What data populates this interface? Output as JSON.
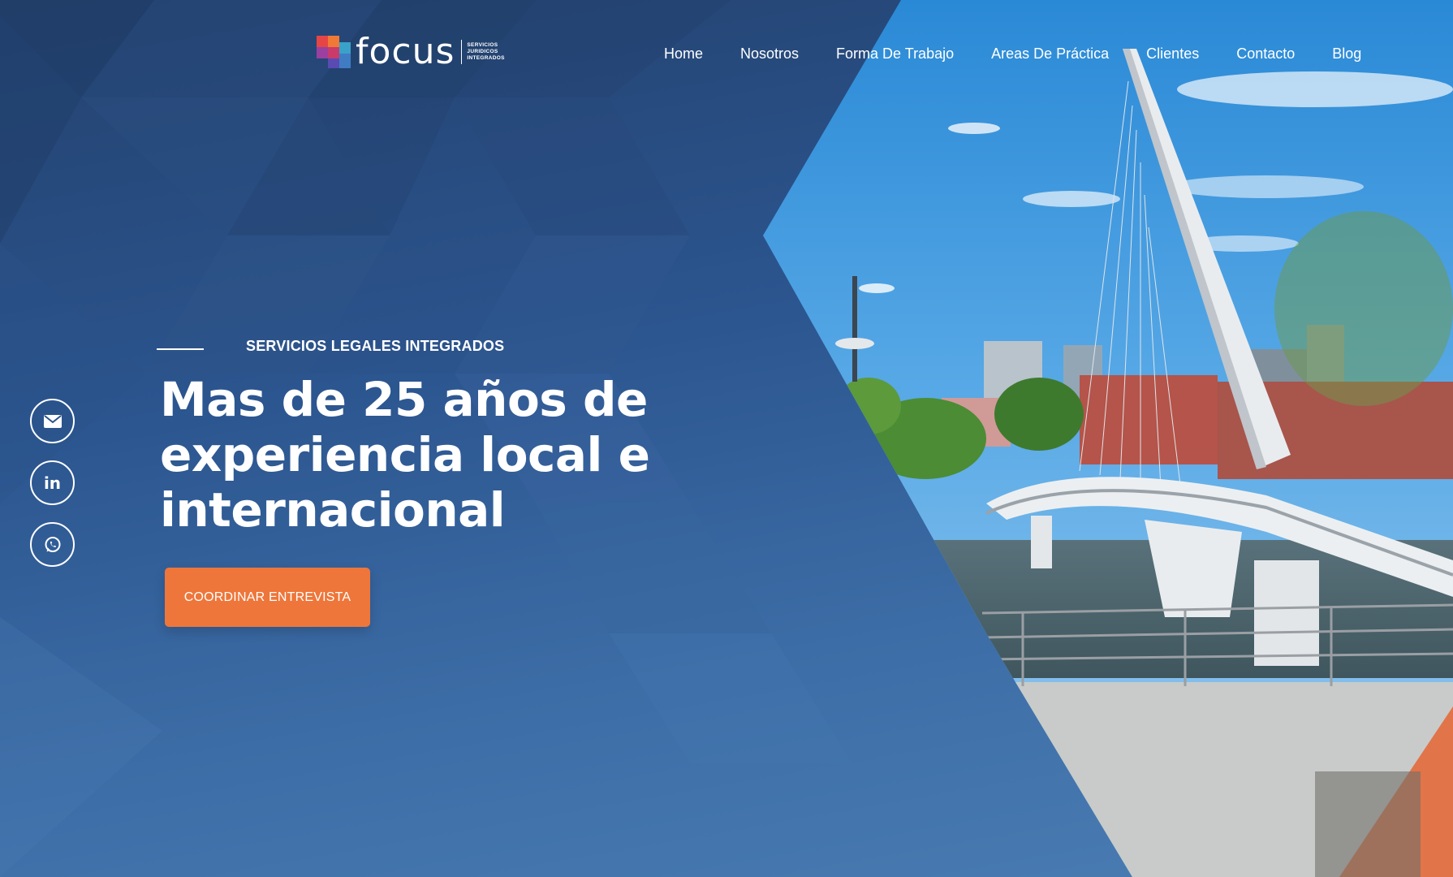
{
  "brand": {
    "name": "focus",
    "tagline_1": "SERVICIOS",
    "tagline_2": "JURIDICOS",
    "tagline_3": "INTEGRADOS"
  },
  "nav": {
    "items": [
      {
        "label": "Home"
      },
      {
        "label": "Nosotros"
      },
      {
        "label": "Forma De Trabajo"
      },
      {
        "label": "Areas De Práctica"
      },
      {
        "label": "Clientes"
      },
      {
        "label": "Contacto"
      },
      {
        "label": "Blog"
      }
    ]
  },
  "hero": {
    "eyebrow": "SERVICIOS LEGALES INTEGRADOS",
    "headline_1": "Mas de 25 años de",
    "headline_2": "experiencia local e",
    "headline_3": "internacional",
    "cta_label": "COORDINAR ENTREVISTA"
  },
  "social": {
    "items": [
      {
        "icon": "envelope-icon"
      },
      {
        "icon": "linkedin-icon",
        "text": "in"
      },
      {
        "icon": "whatsapp-icon"
      }
    ]
  },
  "colors": {
    "accent": "#ee763a",
    "background": "#2b5288",
    "text": "#ffffff"
  }
}
